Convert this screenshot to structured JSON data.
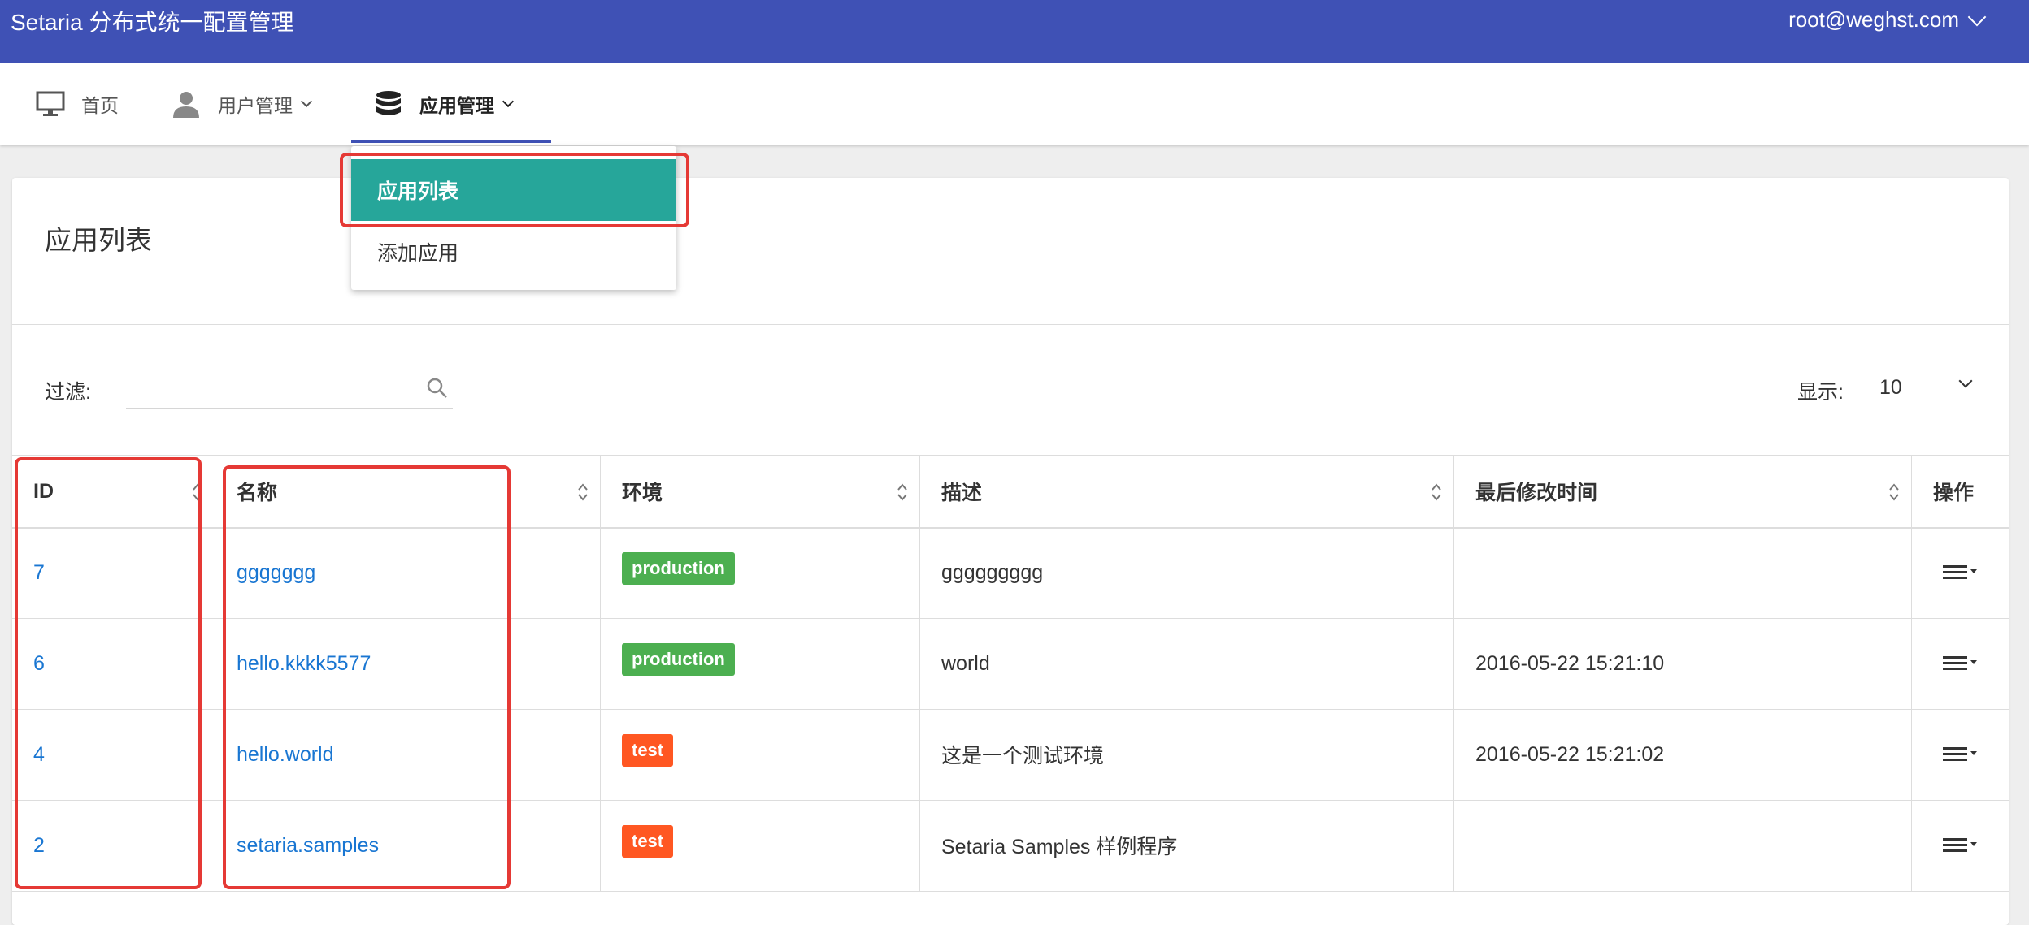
{
  "header": {
    "brand": "Setaria 分布式统一配置管理",
    "account": "root@weghst.com"
  },
  "nav": [
    {
      "label": "首页",
      "icon": "monitor-icon"
    },
    {
      "label": "用户管理",
      "icon": "user-icon"
    },
    {
      "label": "应用管理",
      "icon": "database-icon"
    }
  ],
  "dropdown": {
    "items": [
      "应用列表",
      "添加应用"
    ]
  },
  "page": {
    "title": "应用列表"
  },
  "filter": {
    "label": "过滤:",
    "value": "",
    "placeholder": ""
  },
  "page_size": {
    "label": "显示:",
    "value": "10"
  },
  "table": {
    "columns": [
      "ID",
      "名称",
      "环境",
      "描述",
      "最后修改时间",
      "操作"
    ],
    "rows": [
      {
        "id": "7",
        "name": "ggggggg",
        "env": "production",
        "desc": "ggggggggg",
        "modified": ""
      },
      {
        "id": "6",
        "name": "hello.kkkk5577",
        "env": "production",
        "desc": "world",
        "modified": "2016-05-22 15:21:10"
      },
      {
        "id": "4",
        "name": "hello.world",
        "env": "test",
        "desc": "这是一个测试环境",
        "modified": "2016-05-22 15:21:02"
      },
      {
        "id": "2",
        "name": "setaria.samples",
        "env": "test",
        "desc": "Setaria Samples 样例程序",
        "modified": ""
      }
    ]
  },
  "colors": {
    "primary": "#3f51b5",
    "teal": "#26a69a",
    "production": "#4caf50",
    "test": "#ff5722",
    "link": "#1976d2",
    "highlight": "#e53935"
  }
}
